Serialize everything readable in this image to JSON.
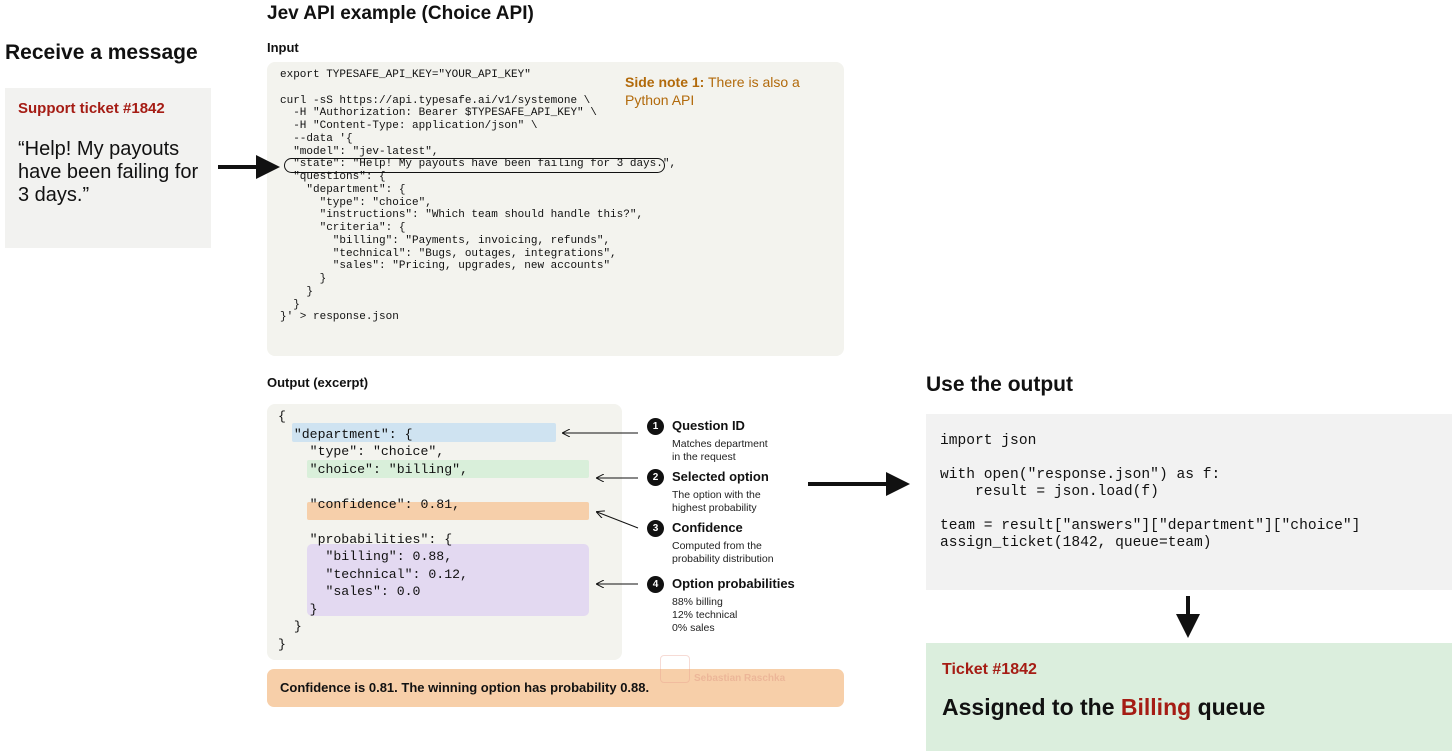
{
  "receive": {
    "title": "Receive a message",
    "ticket_id": "Support ticket #1842",
    "message": "“Help! My payouts have been failing for 3 days.”"
  },
  "api": {
    "title": "Jev API example (Choice API)",
    "input_label": "Input",
    "input_code": "export TYPESAFE_API_KEY=\"YOUR_API_KEY\"\n\ncurl -sS https://api.typesafe.ai/v1/systemone \\\n  -H \"Authorization: Bearer $TYPESAFE_API_KEY\" \\\n  -H \"Content-Type: application/json\" \\\n  --data '{\n  \"model\": \"jev-latest\",\n  \"state\": \"Help! My payouts have been failing for 3 days.\",\n  \"questions\": {\n    \"department\": {\n      \"type\": \"choice\",\n      \"instructions\": \"Which team should handle this?\",\n      \"criteria\": {\n        \"billing\": \"Payments, invoicing, refunds\",\n        \"technical\": \"Bugs, outages, integrations\",\n        \"sales\": \"Pricing, upgrades, new accounts\"\n      }\n    }\n  }\n}' > response.json",
    "side_note_label": "Side note 1:",
    "side_note_text": " There is also a Python API",
    "output_label": "Output (excerpt)",
    "output_code": "{\n  \"department\": {\n    \"type\": \"choice\",\n    \"choice\": \"billing\",\n\n    \"confidence\": 0.81,\n\n    \"probabilities\": {\n      \"billing\": 0.88,\n      \"technical\": 0.12,\n      \"sales\": 0.0\n    }\n  }\n}",
    "confidence_summary": "Confidence is 0.81. The winning option has probability 0.88.",
    "watermark": "Sebastian Raschka"
  },
  "callouts": [
    {
      "number": "1",
      "title": "Question ID",
      "description": "Matches department\nin the request"
    },
    {
      "number": "2",
      "title": "Selected option",
      "description": "The option with the\nhighest probability"
    },
    {
      "number": "3",
      "title": "Confidence",
      "description": "Computed from the\nprobability distribution"
    },
    {
      "number": "4",
      "title": "Option probabilities",
      "description": "88% billing\n12% technical\n0% sales"
    }
  ],
  "use": {
    "title": "Use the output",
    "code": "import json\n\nwith open(\"response.json\") as f:\n    result = json.load(f)\n\nteam = result[\"answers\"][\"department\"][\"choice\"]\nassign_ticket(1842, queue=team)",
    "result_ticket": "Ticket #1842",
    "result_prefix": "Assigned to the ",
    "result_queue": "Billing",
    "result_suffix": " queue"
  },
  "colors": {
    "ticket_red": "#a51c14",
    "side_note_orange": "#b26a0b",
    "highlight_blue": "#cfe3f1",
    "highlight_green": "#d9efda",
    "highlight_orange": "#f6cfaa",
    "highlight_purple": "#e3d9f1",
    "result_green": "#dbeedd"
  }
}
